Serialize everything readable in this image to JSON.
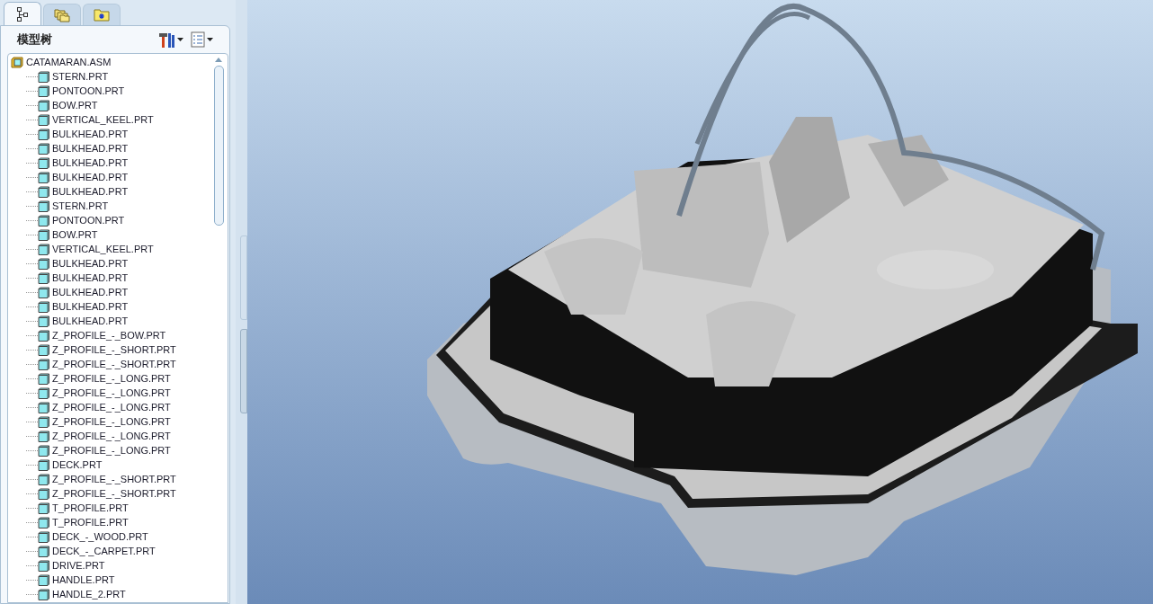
{
  "navigator_tabs": [
    {
      "kind": "tree",
      "selected": true
    },
    {
      "kind": "folders",
      "selected": false
    },
    {
      "kind": "favorites",
      "selected": false
    }
  ],
  "panel": {
    "title": "模型树"
  },
  "tree": {
    "label": "CATAMARAN.ASM",
    "children": [
      {
        "label": "STERN.PRT"
      },
      {
        "label": "PONTOON.PRT"
      },
      {
        "label": "BOW.PRT"
      },
      {
        "label": "VERTICAL_KEEL.PRT"
      },
      {
        "label": "BULKHEAD.PRT"
      },
      {
        "label": "BULKHEAD.PRT"
      },
      {
        "label": "BULKHEAD.PRT"
      },
      {
        "label": "BULKHEAD.PRT"
      },
      {
        "label": "BULKHEAD.PRT"
      },
      {
        "label": "STERN.PRT"
      },
      {
        "label": "PONTOON.PRT"
      },
      {
        "label": "BOW.PRT"
      },
      {
        "label": "VERTICAL_KEEL.PRT"
      },
      {
        "label": "BULKHEAD.PRT"
      },
      {
        "label": "BULKHEAD.PRT"
      },
      {
        "label": "BULKHEAD.PRT"
      },
      {
        "label": "BULKHEAD.PRT"
      },
      {
        "label": "BULKHEAD.PRT"
      },
      {
        "label": "Z_PROFILE_-_BOW.PRT"
      },
      {
        "label": "Z_PROFILE_-_SHORT.PRT"
      },
      {
        "label": "Z_PROFILE_-_SHORT.PRT"
      },
      {
        "label": "Z_PROFILE_-_LONG.PRT"
      },
      {
        "label": "Z_PROFILE_-_LONG.PRT"
      },
      {
        "label": "Z_PROFILE_-_LONG.PRT"
      },
      {
        "label": "Z_PROFILE_-_LONG.PRT"
      },
      {
        "label": "Z_PROFILE_-_LONG.PRT"
      },
      {
        "label": "Z_PROFILE_-_LONG.PRT"
      },
      {
        "label": "DECK.PRT"
      },
      {
        "label": "Z_PROFILE_-_SHORT.PRT"
      },
      {
        "label": "Z_PROFILE_-_SHORT.PRT"
      },
      {
        "label": "T_PROFILE.PRT"
      },
      {
        "label": "T_PROFILE.PRT"
      },
      {
        "label": "DECK_-_WOOD.PRT"
      },
      {
        "label": "DECK_-_CARPET.PRT"
      },
      {
        "label": "DRIVE.PRT"
      },
      {
        "label": "HANDLE.PRT"
      },
      {
        "label": "HANDLE_2.PRT"
      }
    ]
  }
}
